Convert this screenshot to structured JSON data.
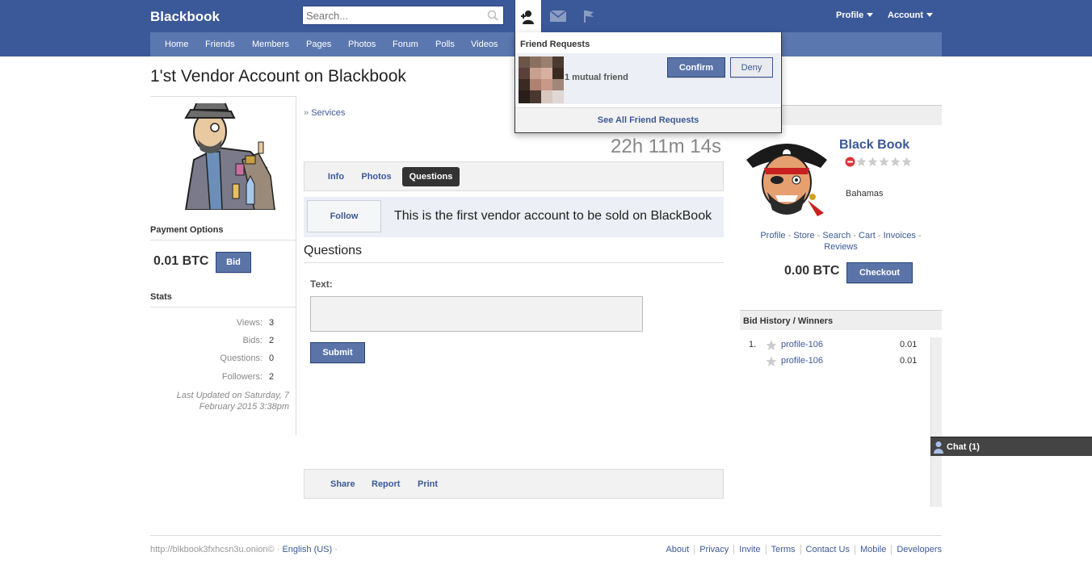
{
  "header": {
    "brand": "Blackbook",
    "search_placeholder": "Search...",
    "profile_label": "Profile",
    "account_label": "Account"
  },
  "nav": [
    "Home",
    "Friends",
    "Members",
    "Pages",
    "Photos",
    "Forum",
    "Polls",
    "Videos"
  ],
  "page_title": "1'st Vendor Account on Blackbook",
  "left": {
    "payment_heading": "Payment Options",
    "price": "0.01 BTC",
    "bid_label": "Bid",
    "stats_heading": "Stats",
    "stats": [
      {
        "label": "Views:",
        "value": "3"
      },
      {
        "label": "Bids:",
        "value": "2"
      },
      {
        "label": "Questions:",
        "value": "0"
      },
      {
        "label": "Followers:",
        "value": "2"
      }
    ],
    "last_updated": "Last Updated on Saturday, 7 February 2015 3:38pm"
  },
  "main": {
    "breadcrumb_prefix": "» ",
    "breadcrumb_link": "Services",
    "timer": "22h 11m 14s",
    "tabs": [
      "Info",
      "Photos",
      "Questions"
    ],
    "follow_label": "Follow",
    "follow_text": "This is the first vendor account to be sold on BlackBook",
    "questions_heading": "Questions",
    "text_label": "Text:",
    "submit_label": "Submit",
    "footer_links": [
      "Share",
      "Report",
      "Print"
    ]
  },
  "right": {
    "store_name": "Black Book",
    "location": "Bahamas",
    "rating_stars": 0,
    "rating_max": 5,
    "store_links": [
      "Profile",
      "Store",
      "Search",
      "Cart",
      "Invoices",
      "Reviews"
    ],
    "price": "0.00 BTC",
    "checkout_label": "Checkout",
    "bid_history_heading": "Bid History / Winners",
    "bids": [
      {
        "rank": "1.",
        "user": "profile-106",
        "amount": "0.01"
      },
      {
        "rank": "",
        "user": "profile-106",
        "amount": "0.01"
      }
    ]
  },
  "friend_requests": {
    "title": "Friend Requests",
    "mutual": "1 mutual friend",
    "confirm_label": "Confirm",
    "deny_label": "Deny",
    "see_all": "See All Friend Requests"
  },
  "chat": {
    "label": "Chat (1)"
  },
  "footer": {
    "site_url": "http://blkbook3fxhcsn3u.onion©",
    "separator": " · ",
    "language": "English (US)",
    "trailing": " ·",
    "links": [
      "About",
      "Privacy",
      "Invite",
      "Terms",
      "Contact Us",
      "Mobile",
      "Developers"
    ]
  },
  "colors": {
    "brand_blue": "#3b5998",
    "nav_blue": "#5b77b0",
    "button_blue": "#5b74a8"
  }
}
